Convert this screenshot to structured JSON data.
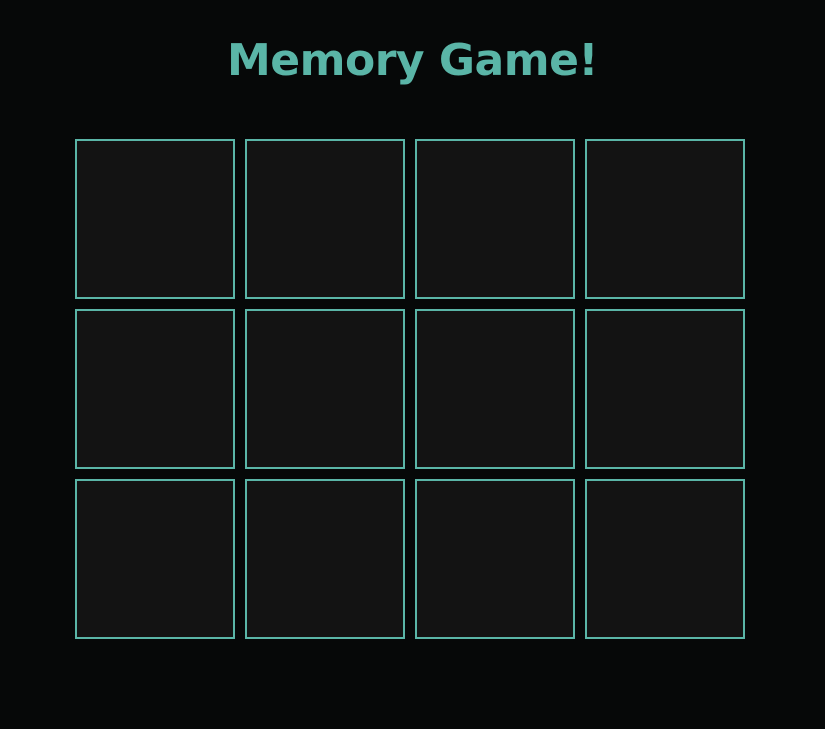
{
  "title": "Memory Game!",
  "colors": {
    "background": "#060808",
    "accent": "#5ab5a7",
    "card_face_down": "#131313"
  },
  "board": {
    "rows": 3,
    "columns": 4,
    "cards": [
      {
        "state": "face-down"
      },
      {
        "state": "face-down"
      },
      {
        "state": "face-down"
      },
      {
        "state": "face-down"
      },
      {
        "state": "face-down"
      },
      {
        "state": "face-down"
      },
      {
        "state": "face-down"
      },
      {
        "state": "face-down"
      },
      {
        "state": "face-down"
      },
      {
        "state": "face-down"
      },
      {
        "state": "face-down"
      },
      {
        "state": "face-down"
      }
    ]
  }
}
